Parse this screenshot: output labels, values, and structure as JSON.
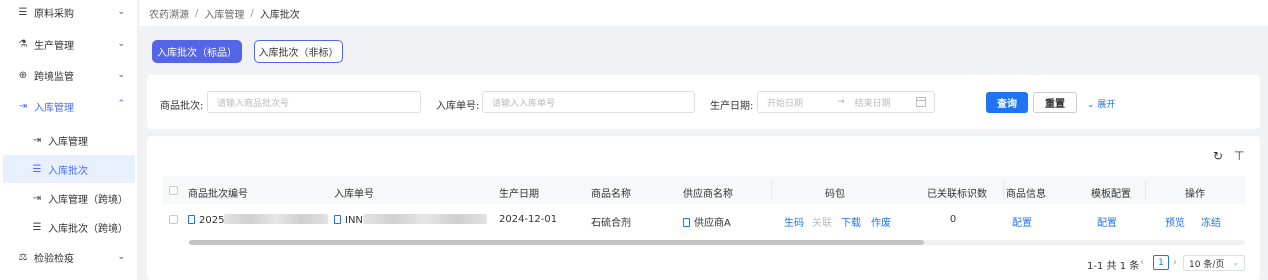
{
  "sidebar": {
    "menu": [
      {
        "label": "原料采购",
        "icon": "list-icon"
      },
      {
        "label": "生产管理",
        "icon": "flask-icon"
      },
      {
        "label": "跨境监管",
        "icon": "globe-icon"
      },
      {
        "label": "入库管理",
        "icon": "login-icon"
      },
      {
        "label": "检验检疫",
        "icon": "scale-icon"
      }
    ],
    "sub_items": [
      {
        "label": "入库管理",
        "icon": "login-icon"
      },
      {
        "label": "入库批次",
        "icon": "list-icon"
      },
      {
        "label": "入库管理（跨境）",
        "icon": "login-icon"
      },
      {
        "label": "入库批次（跨境）",
        "icon": "list-icon"
      }
    ]
  },
  "breadcrumb": {
    "items": [
      "农药溯源",
      "入库管理",
      "入库批次"
    ],
    "separator": "/"
  },
  "tabs": {
    "primary": "入库批次（标品）",
    "secondary": "入库批次（非标）"
  },
  "filters": {
    "batch_label": "商品批次:",
    "batch_placeholder": "请输入商品批次号",
    "order_label": "入库单号:",
    "order_placeholder": "请输入入库单号",
    "date_label": "生产日期:",
    "date_start": "开始日期",
    "date_arrow": "→",
    "date_end": "结束日期",
    "query_btn": "查询",
    "reset_btn": "重置",
    "expand": "展开"
  },
  "table": {
    "columns": [
      "商品批次编号",
      "入库单号",
      "生产日期",
      "商品名称",
      "供应商名称",
      "码包",
      "已关联标识数",
      "商品信息",
      "模板配置",
      "操作"
    ],
    "rows": [
      {
        "batch_no": "2025",
        "order_no": "INN",
        "date": "2024-12-01",
        "product": "石硫合剂",
        "supplier": "供应商A",
        "code_actions": [
          "生码",
          "关联",
          "下载",
          "作废"
        ],
        "linked_count": "0",
        "product_info": "配置",
        "template": "配置",
        "ops": [
          "预览",
          "冻结"
        ]
      }
    ]
  },
  "pagination": {
    "summary": "1-1 共 1 条",
    "prev": "‹",
    "page": "1",
    "next": "›",
    "page_size": "10 条/页"
  },
  "colors": {
    "primary": "#1f74f2",
    "tab_active": "#5565e8",
    "menu_active": "#4a6cf7"
  }
}
